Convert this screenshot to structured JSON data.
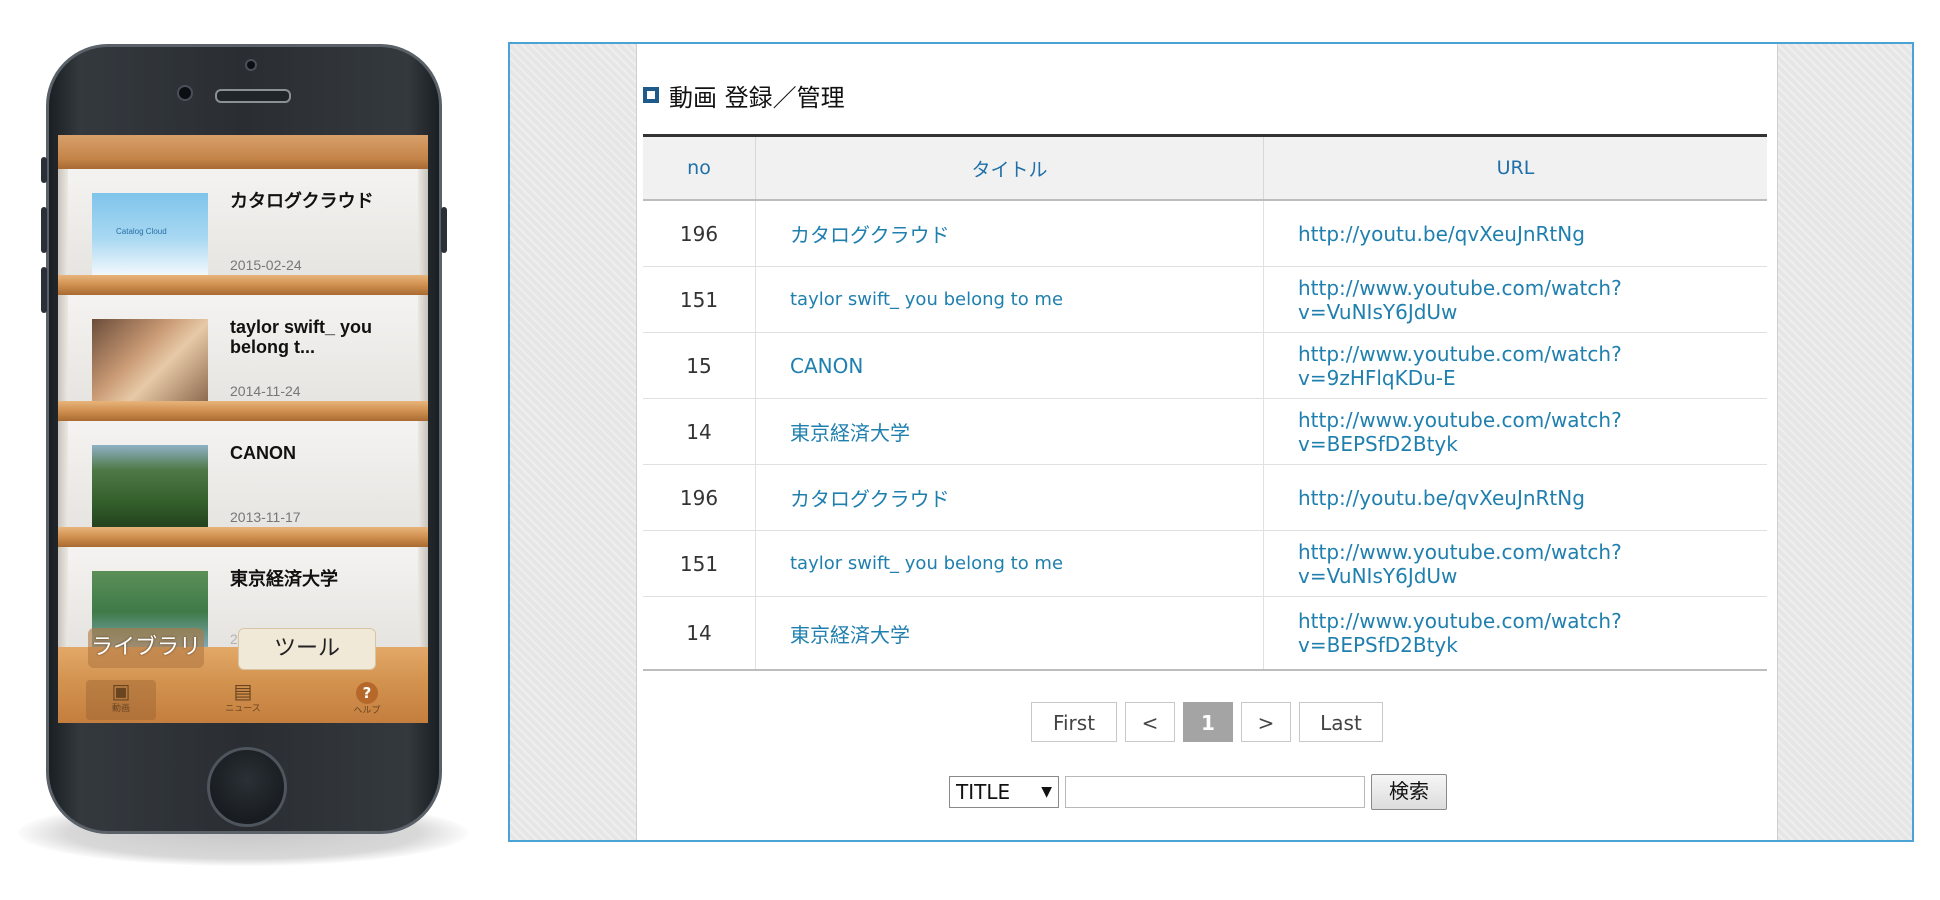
{
  "phone": {
    "videos": [
      {
        "title": "カタログクラウド",
        "date": "2015-02-24",
        "thumb_brand": "Catalog Cloud",
        "thumb": "catalog-cloud-thumbnail"
      },
      {
        "title": "taylor swift_ you belong t...",
        "date": "2014-11-24",
        "thumb": "taylor-swift-thumbnail"
      },
      {
        "title": "CANON",
        "date": "2013-11-17",
        "thumb": "canon-thumbnail"
      },
      {
        "title": "東京経済大学",
        "date": "2013-11-17",
        "thumb": "tokyo-keizai-thumbnail"
      }
    ],
    "segments": {
      "library": "ライブラリ",
      "tools": "ツール"
    },
    "tabs": [
      {
        "label": "動画",
        "icon": "film-icon"
      },
      {
        "label": "ニュース",
        "icon": "clipboard-icon"
      },
      {
        "label": "ヘルプ",
        "icon": "help-icon"
      }
    ]
  },
  "admin": {
    "section_title": "動画 登録／管理",
    "columns": {
      "no": "no",
      "title": "タイトル",
      "url": "URL"
    },
    "rows": [
      {
        "no": "196",
        "title": "カタログクラウド",
        "url": "http://youtu.be/qvXeuJnRtNg"
      },
      {
        "no": "151",
        "title": "taylor swift_ you belong to me",
        "url": "http://www.youtube.com/watch?v=VuNIsY6JdUw"
      },
      {
        "no": "15",
        "title": "CANON",
        "url": "http://www.youtube.com/watch?v=9zHFlqKDu-E"
      },
      {
        "no": "14",
        "title": "東京経済大学",
        "url": "http://www.youtube.com/watch?v=BEPSfD2Btyk"
      },
      {
        "no": "196",
        "title": "カタログクラウド",
        "url": "http://youtu.be/qvXeuJnRtNg"
      },
      {
        "no": "151",
        "title": "taylor swift_ you belong to me",
        "url": "http://www.youtube.com/watch?v=VuNIsY6JdUw"
      },
      {
        "no": "14",
        "title": "東京経済大学",
        "url": "http://www.youtube.com/watch?v=BEPSfD2Btyk"
      }
    ],
    "pagination": {
      "first": "First",
      "prev": "<",
      "current": "1",
      "next": ">",
      "last": "Last"
    },
    "search": {
      "field_select": "TITLE",
      "select_arrow": "▼",
      "input_value": "",
      "button": "検索"
    },
    "colors": {
      "frame_border": "#4aa3d4",
      "link": "#1f7fae",
      "title_square": "#1e5a8a"
    }
  }
}
